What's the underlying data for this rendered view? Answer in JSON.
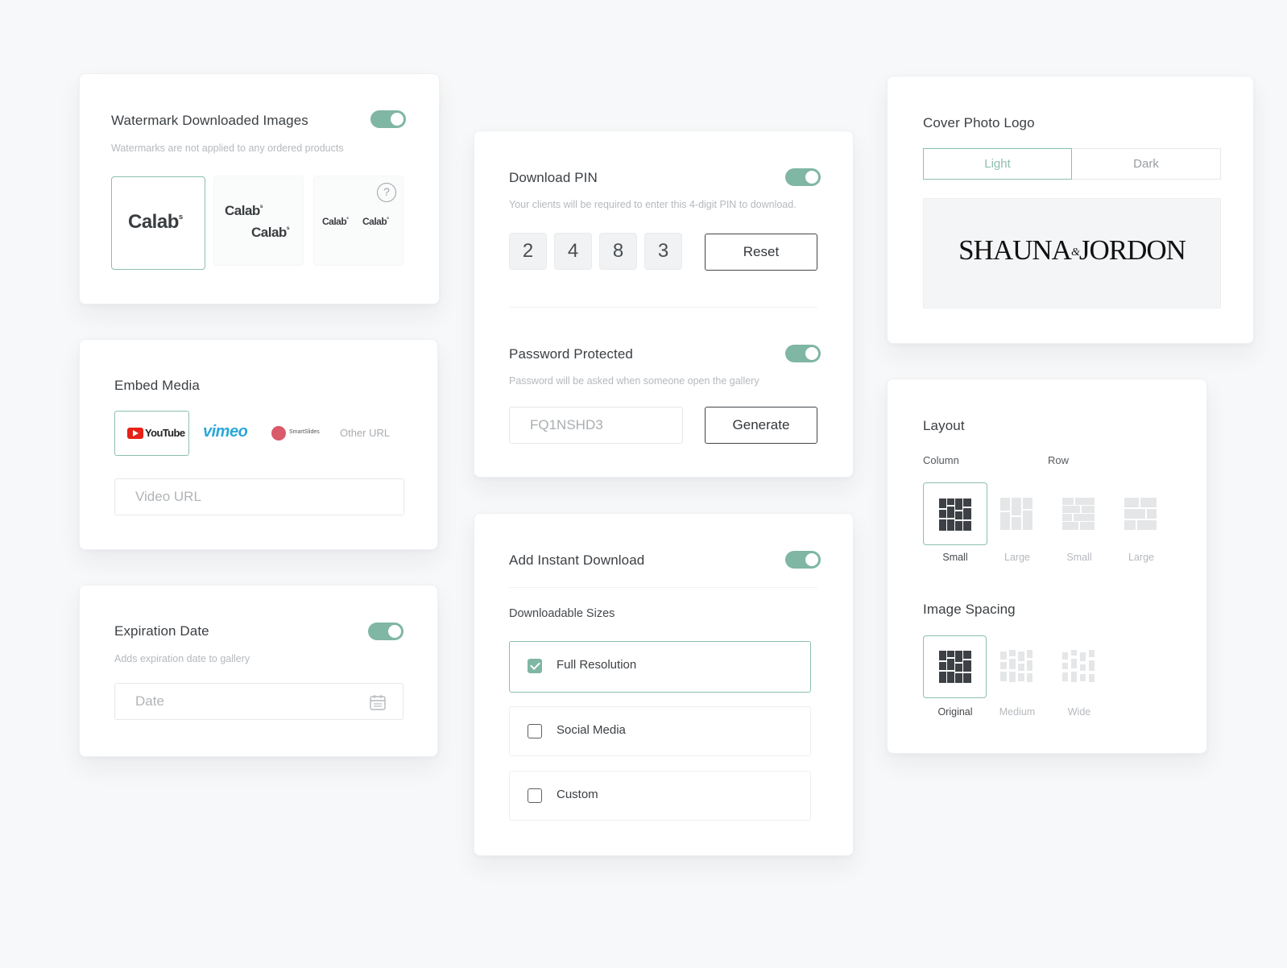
{
  "watermark": {
    "title": "Watermark Downloaded Images",
    "subtitle": "Watermarks are not applied to any ordered products",
    "logo_text": "Calab",
    "logo_super": "s",
    "help_glyph": "?"
  },
  "embed": {
    "title": "Embed Media",
    "youtube_label": "YouTube",
    "vimeo_label": "vimeo",
    "smartslides_label": "SmartSlides",
    "other_label": "Other URL",
    "url_placeholder": "Video URL"
  },
  "expiration": {
    "title": "Expiration Date",
    "subtitle": "Adds expiration date to gallery",
    "date_placeholder": "Date"
  },
  "download_pin": {
    "title": "Download PIN",
    "subtitle": "Your clients will be required to enter this 4-digit PIN to download.",
    "digits": [
      "2",
      "4",
      "8",
      "3"
    ],
    "reset_label": "Reset"
  },
  "password": {
    "title": "Password Protected",
    "subtitle": "Password will be asked when someone open the gallery",
    "value": "FQ1NSHD3",
    "generate_label": "Generate"
  },
  "instant_download": {
    "title": "Add Instant Download",
    "sizes_heading": "Downloadable Sizes",
    "sizes": [
      {
        "label": "Full Resolution",
        "checked": true
      },
      {
        "label": "Social Media",
        "checked": false
      },
      {
        "label": "Custom",
        "checked": false
      }
    ]
  },
  "cover_logo": {
    "title": "Cover Photo Logo",
    "tabs": [
      "Light",
      "Dark"
    ],
    "selected_tab": "Light",
    "logo_left": "SHAUNA",
    "logo_amp": "&",
    "logo_right": "JORDON"
  },
  "layout": {
    "title": "Layout",
    "column_heading": "Column",
    "row_heading": "Row",
    "options": [
      "Small",
      "Large",
      "Small",
      "Large"
    ],
    "selected_option": 0,
    "spacing_title": "Image Spacing",
    "spacing_options": [
      "Original",
      "Medium",
      "Wide"
    ],
    "selected_spacing": 0
  },
  "colors": {
    "accent": "#7fb6a4",
    "accent_border": "#8cbfae",
    "background": "#f7f8f9",
    "card": "#ffffff",
    "dark_tile": "#3d4145",
    "light_tile": "#e4e6e8"
  }
}
